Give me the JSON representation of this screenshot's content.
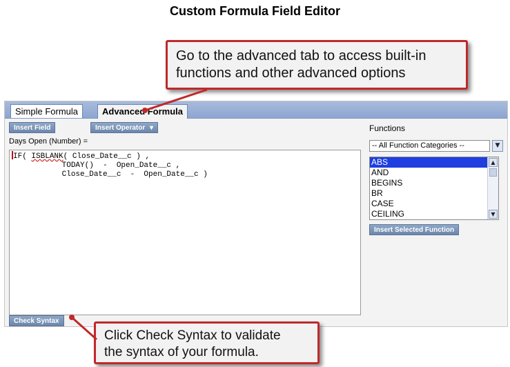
{
  "page_title": "Custom Formula Field Editor",
  "callouts": {
    "advanced_tab_line1": "Go to the advanced tab to access built-in",
    "advanced_tab_line2": "functions and other advanced options",
    "check_syntax_line1": "Click Check Syntax to validate",
    "check_syntax_line2": "the syntax of your formula."
  },
  "tabs": {
    "simple": "Simple Formula",
    "advanced": "Advanced Formula"
  },
  "toolbar": {
    "insert_field": "Insert Field",
    "insert_operator": "Insert Operator",
    "operator_arrow": "▾"
  },
  "formula": {
    "label": "Days Open (Number) =",
    "if_kw": "IF(",
    "isblank": "ISBLANK",
    "line1_rest": "( Close_Date__c ) ,",
    "line2": "           TODAY()  -  Open_Date__c ,",
    "line3": "           Close_Date__c  -  Open_Date__c )"
  },
  "functions": {
    "label": "Functions",
    "category_selected": "-- All Function Categories --",
    "items": [
      "ABS",
      "AND",
      "BEGINS",
      "BR",
      "CASE",
      "CEILING"
    ],
    "selected": "ABS",
    "insert_button": "Insert Selected Function"
  },
  "check_syntax_button": "Check Syntax",
  "colors": {
    "callout_border": "#c0282a",
    "tab_bar": "#9bb1d8",
    "button": "#7891b5",
    "list_selection": "#1f3fe0"
  }
}
